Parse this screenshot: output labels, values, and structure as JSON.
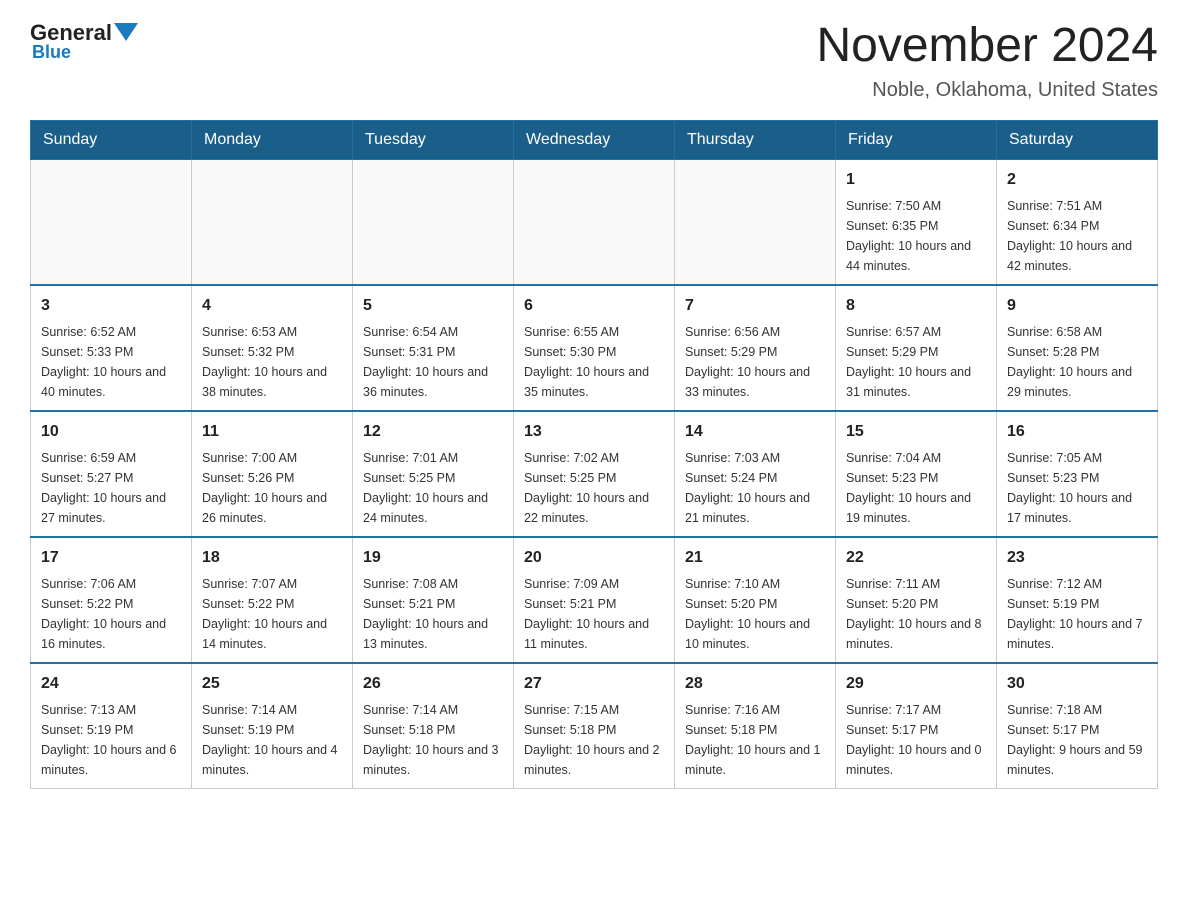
{
  "header": {
    "logo_general": "General",
    "logo_blue": "Blue",
    "month_title": "November 2024",
    "location": "Noble, Oklahoma, United States"
  },
  "days_of_week": [
    "Sunday",
    "Monday",
    "Tuesday",
    "Wednesday",
    "Thursday",
    "Friday",
    "Saturday"
  ],
  "weeks": [
    [
      {
        "day": "",
        "info": ""
      },
      {
        "day": "",
        "info": ""
      },
      {
        "day": "",
        "info": ""
      },
      {
        "day": "",
        "info": ""
      },
      {
        "day": "",
        "info": ""
      },
      {
        "day": "1",
        "info": "Sunrise: 7:50 AM\nSunset: 6:35 PM\nDaylight: 10 hours and 44 minutes."
      },
      {
        "day": "2",
        "info": "Sunrise: 7:51 AM\nSunset: 6:34 PM\nDaylight: 10 hours and 42 minutes."
      }
    ],
    [
      {
        "day": "3",
        "info": "Sunrise: 6:52 AM\nSunset: 5:33 PM\nDaylight: 10 hours and 40 minutes."
      },
      {
        "day": "4",
        "info": "Sunrise: 6:53 AM\nSunset: 5:32 PM\nDaylight: 10 hours and 38 minutes."
      },
      {
        "day": "5",
        "info": "Sunrise: 6:54 AM\nSunset: 5:31 PM\nDaylight: 10 hours and 36 minutes."
      },
      {
        "day": "6",
        "info": "Sunrise: 6:55 AM\nSunset: 5:30 PM\nDaylight: 10 hours and 35 minutes."
      },
      {
        "day": "7",
        "info": "Sunrise: 6:56 AM\nSunset: 5:29 PM\nDaylight: 10 hours and 33 minutes."
      },
      {
        "day": "8",
        "info": "Sunrise: 6:57 AM\nSunset: 5:29 PM\nDaylight: 10 hours and 31 minutes."
      },
      {
        "day": "9",
        "info": "Sunrise: 6:58 AM\nSunset: 5:28 PM\nDaylight: 10 hours and 29 minutes."
      }
    ],
    [
      {
        "day": "10",
        "info": "Sunrise: 6:59 AM\nSunset: 5:27 PM\nDaylight: 10 hours and 27 minutes."
      },
      {
        "day": "11",
        "info": "Sunrise: 7:00 AM\nSunset: 5:26 PM\nDaylight: 10 hours and 26 minutes."
      },
      {
        "day": "12",
        "info": "Sunrise: 7:01 AM\nSunset: 5:25 PM\nDaylight: 10 hours and 24 minutes."
      },
      {
        "day": "13",
        "info": "Sunrise: 7:02 AM\nSunset: 5:25 PM\nDaylight: 10 hours and 22 minutes."
      },
      {
        "day": "14",
        "info": "Sunrise: 7:03 AM\nSunset: 5:24 PM\nDaylight: 10 hours and 21 minutes."
      },
      {
        "day": "15",
        "info": "Sunrise: 7:04 AM\nSunset: 5:23 PM\nDaylight: 10 hours and 19 minutes."
      },
      {
        "day": "16",
        "info": "Sunrise: 7:05 AM\nSunset: 5:23 PM\nDaylight: 10 hours and 17 minutes."
      }
    ],
    [
      {
        "day": "17",
        "info": "Sunrise: 7:06 AM\nSunset: 5:22 PM\nDaylight: 10 hours and 16 minutes."
      },
      {
        "day": "18",
        "info": "Sunrise: 7:07 AM\nSunset: 5:22 PM\nDaylight: 10 hours and 14 minutes."
      },
      {
        "day": "19",
        "info": "Sunrise: 7:08 AM\nSunset: 5:21 PM\nDaylight: 10 hours and 13 minutes."
      },
      {
        "day": "20",
        "info": "Sunrise: 7:09 AM\nSunset: 5:21 PM\nDaylight: 10 hours and 11 minutes."
      },
      {
        "day": "21",
        "info": "Sunrise: 7:10 AM\nSunset: 5:20 PM\nDaylight: 10 hours and 10 minutes."
      },
      {
        "day": "22",
        "info": "Sunrise: 7:11 AM\nSunset: 5:20 PM\nDaylight: 10 hours and 8 minutes."
      },
      {
        "day": "23",
        "info": "Sunrise: 7:12 AM\nSunset: 5:19 PM\nDaylight: 10 hours and 7 minutes."
      }
    ],
    [
      {
        "day": "24",
        "info": "Sunrise: 7:13 AM\nSunset: 5:19 PM\nDaylight: 10 hours and 6 minutes."
      },
      {
        "day": "25",
        "info": "Sunrise: 7:14 AM\nSunset: 5:19 PM\nDaylight: 10 hours and 4 minutes."
      },
      {
        "day": "26",
        "info": "Sunrise: 7:14 AM\nSunset: 5:18 PM\nDaylight: 10 hours and 3 minutes."
      },
      {
        "day": "27",
        "info": "Sunrise: 7:15 AM\nSunset: 5:18 PM\nDaylight: 10 hours and 2 minutes."
      },
      {
        "day": "28",
        "info": "Sunrise: 7:16 AM\nSunset: 5:18 PM\nDaylight: 10 hours and 1 minute."
      },
      {
        "day": "29",
        "info": "Sunrise: 7:17 AM\nSunset: 5:17 PM\nDaylight: 10 hours and 0 minutes."
      },
      {
        "day": "30",
        "info": "Sunrise: 7:18 AM\nSunset: 5:17 PM\nDaylight: 9 hours and 59 minutes."
      }
    ]
  ]
}
